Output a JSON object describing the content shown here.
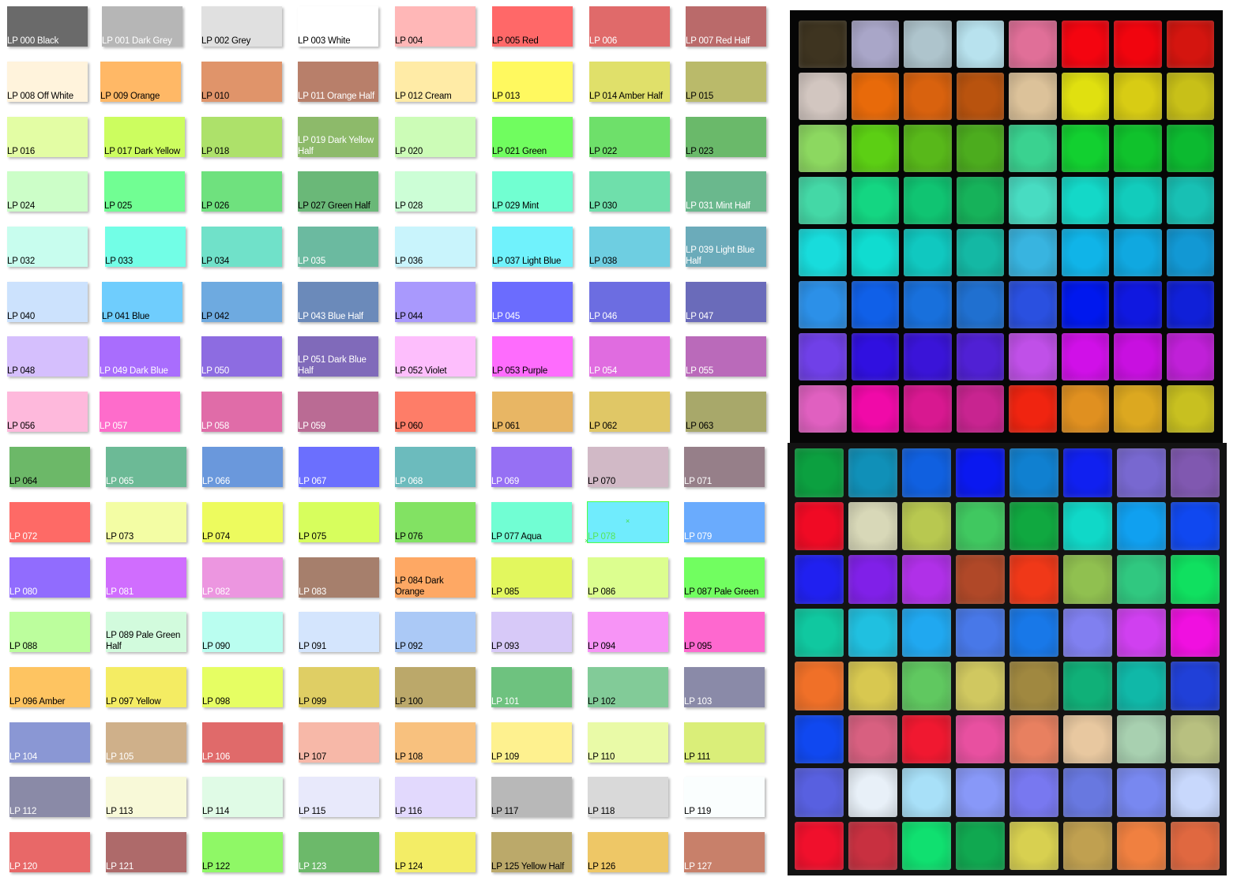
{
  "swatches": [
    {
      "label": "LP 000 Black",
      "color": "#6a6a6a",
      "text": "light"
    },
    {
      "label": "LP 001 Dark Grey",
      "color": "#b6b6b6",
      "text": "light"
    },
    {
      "label": "LP 002 Grey",
      "color": "#e0e0e0",
      "text": "dark"
    },
    {
      "label": "LP 003 White",
      "color": "#ffffff",
      "text": "dark"
    },
    {
      "label": "LP 004",
      "color": "#ffb7b7",
      "text": "dark"
    },
    {
      "label": "LP 005 Red",
      "color": "#ff6868",
      "text": "dark"
    },
    {
      "label": "LP 006",
      "color": "#e06a6a",
      "text": "light"
    },
    {
      "label": "LP 007 Red Half",
      "color": "#ba6a6a",
      "text": "light"
    },
    {
      "label": "LP 008 Off White",
      "color": "#fff3dc",
      "text": "dark"
    },
    {
      "label": "LP 009 Orange",
      "color": "#ffb866",
      "text": "dark"
    },
    {
      "label": "LP 010",
      "color": "#e0946a",
      "text": "dark"
    },
    {
      "label": "LP 011 Orange Half",
      "color": "#b87f6a",
      "text": "light"
    },
    {
      "label": "LP 012 Cream",
      "color": "#ffeba6",
      "text": "dark"
    },
    {
      "label": "LP 013",
      "color": "#fff95f",
      "text": "dark"
    },
    {
      "label": "LP 014 Amber Half",
      "color": "#e0e06a",
      "text": "dark"
    },
    {
      "label": "LP 015",
      "color": "#baba6a",
      "text": "dark"
    },
    {
      "label": "LP 016",
      "color": "#e3fda4",
      "text": "dark"
    },
    {
      "label": "LP 017 Dark Yellow",
      "color": "#ccfd5f",
      "text": "dark"
    },
    {
      "label": "LP 018",
      "color": "#ade16a",
      "text": "dark"
    },
    {
      "label": "LP 019 Dark Yellow Half",
      "color": "#8dba6a",
      "text": "light"
    },
    {
      "label": "LP 020",
      "color": "#ccfcb7",
      "text": "dark"
    },
    {
      "label": "LP 021 Green",
      "color": "#70fd5f",
      "text": "dark"
    },
    {
      "label": "LP 022",
      "color": "#6ee06a",
      "text": "dark"
    },
    {
      "label": "LP 023",
      "color": "#6ab96a",
      "text": "dark"
    },
    {
      "label": "LP 024",
      "color": "#ccfec8",
      "text": "dark"
    },
    {
      "label": "LP 025",
      "color": "#71fe93",
      "text": "dark"
    },
    {
      "label": "LP 026",
      "color": "#6fe17e",
      "text": "dark"
    },
    {
      "label": "LP 027 Green Half",
      "color": "#6ab878",
      "text": "dark"
    },
    {
      "label": "LP 028",
      "color": "#ccfed6",
      "text": "dark"
    },
    {
      "label": "LP 029 Mint",
      "color": "#71ffd1",
      "text": "dark"
    },
    {
      "label": "LP 030",
      "color": "#6fdfab",
      "text": "dark"
    },
    {
      "label": "LP 031 Mint Half",
      "color": "#6ab88d",
      "text": "light"
    },
    {
      "label": "LP 032",
      "color": "#c8fdee",
      "text": "dark"
    },
    {
      "label": "LP 033",
      "color": "#72fee6",
      "text": "dark"
    },
    {
      "label": "LP 034",
      "color": "#70e1c9",
      "text": "dark"
    },
    {
      "label": "LP 035",
      "color": "#6bbaa0",
      "text": "light"
    },
    {
      "label": "LP 036",
      "color": "#c9f4fc",
      "text": "dark"
    },
    {
      "label": "LP 037 Light Blue",
      "color": "#70f2fc",
      "text": "dark"
    },
    {
      "label": "LP 038",
      "color": "#6ecee1",
      "text": "dark"
    },
    {
      "label": "LP 039 Light Blue Half",
      "color": "#6babba",
      "text": "light"
    },
    {
      "label": "LP 040",
      "color": "#cce2fd",
      "text": "dark"
    },
    {
      "label": "LP 041 Blue",
      "color": "#6fcdfd",
      "text": "dark"
    },
    {
      "label": "LP 042",
      "color": "#6eaae0",
      "text": "dark"
    },
    {
      "label": "LP 043 Blue Half",
      "color": "#6b8aba",
      "text": "light"
    },
    {
      "label": "LP 044",
      "color": "#a999fd",
      "text": "dark"
    },
    {
      "label": "LP 045",
      "color": "#6b6cfe",
      "text": "light"
    },
    {
      "label": "LP 046",
      "color": "#6c6de1",
      "text": "light"
    },
    {
      "label": "LP 047",
      "color": "#6a6bba",
      "text": "light"
    },
    {
      "label": "LP 048",
      "color": "#d5bffd",
      "text": "dark"
    },
    {
      "label": "LP 049 Dark Blue",
      "color": "#a96dfd",
      "text": "light"
    },
    {
      "label": "LP 050",
      "color": "#8d6ce1",
      "text": "light"
    },
    {
      "label": "LP 051 Dark Blue Half",
      "color": "#806aba",
      "text": "light"
    },
    {
      "label": "LP 052 Violet",
      "color": "#fdbefc",
      "text": "dark"
    },
    {
      "label": "LP 053 Purple",
      "color": "#fe6cfd",
      "text": "dark"
    },
    {
      "label": "LP 054",
      "color": "#e06ce0",
      "text": "light"
    },
    {
      "label": "LP 055",
      "color": "#ba6aba",
      "text": "light"
    },
    {
      "label": "LP 056",
      "color": "#feb9dc",
      "text": "dark"
    },
    {
      "label": "LP 057",
      "color": "#fe6ccb",
      "text": "light"
    },
    {
      "label": "LP 058",
      "color": "#e06ca8",
      "text": "light"
    },
    {
      "label": "LP 059",
      "color": "#ba6b94",
      "text": "light"
    },
    {
      "label": "LP 060",
      "color": "#fe7d68",
      "text": "dark"
    },
    {
      "label": "LP 061",
      "color": "#e8b664",
      "text": "dark"
    },
    {
      "label": "LP 062",
      "color": "#e0c766",
      "text": "dark"
    },
    {
      "label": "LP 063",
      "color": "#a8a86a",
      "text": "dark"
    },
    {
      "label": "LP 064",
      "color": "#6cb868",
      "text": "dark"
    },
    {
      "label": "LP 065",
      "color": "#6cba96",
      "text": "light"
    },
    {
      "label": "LP 066",
      "color": "#6a98dc",
      "text": "light"
    },
    {
      "label": "LP 067",
      "color": "#6b6ffe",
      "text": "light"
    },
    {
      "label": "LP 068",
      "color": "#6cbbbd",
      "text": "light"
    },
    {
      "label": "LP 069",
      "color": "#9670f4",
      "text": "light"
    },
    {
      "label": "LP 070",
      "color": "#d1b9c6",
      "text": "dark"
    },
    {
      "label": "LP 071",
      "color": "#967f89",
      "text": "light"
    },
    {
      "label": "LP 072",
      "color": "#fe6a66",
      "text": "light"
    },
    {
      "label": "LP 073",
      "color": "#f3fda4",
      "text": "dark"
    },
    {
      "label": "LP 074",
      "color": "#edfb5e",
      "text": "dark"
    },
    {
      "label": "LP 075",
      "color": "#d7fe5d",
      "text": "dark"
    },
    {
      "label": "LP 076",
      "color": "#82e263",
      "text": "dark"
    },
    {
      "label": "LP 077 Aqua",
      "color": "#71fed3",
      "text": "dark"
    },
    {
      "label": "LP 078",
      "color": "#70ecfd",
      "text": "dark",
      "selected": true
    },
    {
      "label": "LP 079",
      "color": "#6aabfd",
      "text": "light"
    },
    {
      "label": "LP 080",
      "color": "#916cfe",
      "text": "light"
    },
    {
      "label": "LP 081",
      "color": "#d06dfe",
      "text": "light"
    },
    {
      "label": "LP 082",
      "color": "#ec96e0",
      "text": "light"
    },
    {
      "label": "LP 083",
      "color": "#a67f6c",
      "text": "light"
    },
    {
      "label": "LP 084 Dark Orange",
      "color": "#fea864",
      "text": "dark"
    },
    {
      "label": "LP 085",
      "color": "#e2f75e",
      "text": "dark"
    },
    {
      "label": "LP 086",
      "color": "#dcfe8f",
      "text": "dark"
    },
    {
      "label": "LP 087 Pale Green",
      "color": "#71fe60",
      "text": "dark"
    },
    {
      "label": "LP 088",
      "color": "#bcfe9d",
      "text": "dark"
    },
    {
      "label": "LP 089 Pale Green Half",
      "color": "#d2fbdd",
      "text": "dark"
    },
    {
      "label": "LP 090",
      "color": "#bafef0",
      "text": "dark"
    },
    {
      "label": "LP 091",
      "color": "#d4e5fd",
      "text": "dark"
    },
    {
      "label": "LP 092",
      "color": "#abc9f6",
      "text": "dark"
    },
    {
      "label": "LP 093",
      "color": "#d7c9f8",
      "text": "dark"
    },
    {
      "label": "LP 094",
      "color": "#f794f6",
      "text": "dark"
    },
    {
      "label": "LP 095",
      "color": "#fe68cf",
      "text": "dark"
    },
    {
      "label": "LP 096 Amber",
      "color": "#fec461",
      "text": "dark"
    },
    {
      "label": "LP 097 Yellow",
      "color": "#f4ec63",
      "text": "dark"
    },
    {
      "label": "LP 098",
      "color": "#e6fe63",
      "text": "dark"
    },
    {
      "label": "LP 099",
      "color": "#dfce64",
      "text": "dark"
    },
    {
      "label": "LP 100",
      "color": "#bba86a",
      "text": "dark"
    },
    {
      "label": "LP 101",
      "color": "#6ec27f",
      "text": "light"
    },
    {
      "label": "LP 102",
      "color": "#82cb98",
      "text": "dark"
    },
    {
      "label": "LP 103",
      "color": "#8a8aa8",
      "text": "light"
    },
    {
      "label": "LP 104",
      "color": "#8a97d4",
      "text": "light"
    },
    {
      "label": "LP 105",
      "color": "#cfb08a",
      "text": "light"
    },
    {
      "label": "LP 106",
      "color": "#e06a6a",
      "text": "light"
    },
    {
      "label": "LP 107",
      "color": "#f7b8a8",
      "text": "dark"
    },
    {
      "label": "LP 108",
      "color": "#f8c17e",
      "text": "dark"
    },
    {
      "label": "LP 109",
      "color": "#fef18f",
      "text": "dark"
    },
    {
      "label": "LP 110",
      "color": "#e9faa7",
      "text": "dark"
    },
    {
      "label": "LP 111",
      "color": "#daee79",
      "text": "dark"
    },
    {
      "label": "LP 112",
      "color": "#8a8aa7",
      "text": "light"
    },
    {
      "label": "LP 113",
      "color": "#f8f9d8",
      "text": "dark"
    },
    {
      "label": "LP 114",
      "color": "#e0fbe6",
      "text": "dark"
    },
    {
      "label": "LP 115",
      "color": "#e8e9fb",
      "text": "dark"
    },
    {
      "label": "LP 116",
      "color": "#e2d9fd",
      "text": "dark"
    },
    {
      "label": "LP 117",
      "color": "#b8b8b8",
      "text": "dark"
    },
    {
      "label": "LP 118",
      "color": "#d9d9d9",
      "text": "dark"
    },
    {
      "label": "LP 119",
      "color": "#fafefe",
      "text": "dark"
    },
    {
      "label": "LP 120",
      "color": "#e86868",
      "text": "light"
    },
    {
      "label": "LP 121",
      "color": "#ae6a6a",
      "text": "light"
    },
    {
      "label": "LP 122",
      "color": "#8ff866",
      "text": "dark"
    },
    {
      "label": "LP 123",
      "color": "#6cb96a",
      "text": "light"
    },
    {
      "label": "LP 124",
      "color": "#f3ed66",
      "text": "dark"
    },
    {
      "label": "LP 125 Yellow Half",
      "color": "#bba96a",
      "text": "dark"
    },
    {
      "label": "LP 126",
      "color": "#eec766",
      "text": "dark"
    },
    {
      "label": "LP 127",
      "color": "#c8806a",
      "text": "light"
    }
  ],
  "photo_top": {
    "pads": [
      "#3e3420",
      "#a9a6c8",
      "#aec4cc",
      "#b8e2ee",
      "#e06f98",
      "#f40510",
      "#f1050e",
      "#d4150f",
      "#d2c6c0",
      "#e86a0a",
      "#d9620e",
      "#b9530e",
      "#dcc29a",
      "#e0e010",
      "#d8cc14",
      "#c8c018",
      "#8cd860",
      "#5ccf14",
      "#58b81a",
      "#4cac1e",
      "#3ad290",
      "#12d030",
      "#10c22c",
      "#0cba30",
      "#44d8a6",
      "#14d682",
      "#10c472",
      "#16b25a",
      "#48dcc2",
      "#14d8c8",
      "#12ccbc",
      "#18c0b4",
      "#18dcdc",
      "#10dcd0",
      "#10c8c0",
      "#14b8a4",
      "#38b4e0",
      "#10b4e8",
      "#10a8e0",
      "#1298d4",
      "#2c90e8",
      "#1060e8",
      "#1870dc",
      "#2070d0",
      "#2a50e0",
      "#0018ee",
      "#1018e0",
      "#1020d8",
      "#7040e8",
      "#3010e0",
      "#3a14d8",
      "#5020d4",
      "#c050e8",
      "#d010e8",
      "#c810e0",
      "#c020d8",
      "#e060c0",
      "#f00aa8",
      "#d81890",
      "#c82490",
      "#f02410",
      "#e09020",
      "#dca820",
      "#c8c020"
    ]
  },
  "photo_bottom": {
    "pads": [
      "#0ca040",
      "#1090b8",
      "#1060e0",
      "#0a18f0",
      "#1080d0",
      "#1020f0",
      "#7868d0",
      "#8058b0",
      "#f00a24",
      "#d8d8b8",
      "#b8c850",
      "#40c860",
      "#10a840",
      "#10d8c8",
      "#10a0f0",
      "#1048f0",
      "#2020f0",
      "#8020e8",
      "#b030e8",
      "#b04828",
      "#f03818",
      "#90c050",
      "#30c880",
      "#10e060",
      "#10c8a0",
      "#20c0e0",
      "#20a8f0",
      "#4878e8",
      "#1878e8",
      "#8080f0",
      "#d040f0",
      "#f010e0",
      "#f07028",
      "#d8c850",
      "#60c860",
      "#d0c860",
      "#a08840",
      "#10b078",
      "#10b8a8",
      "#2040d8",
      "#1048f0",
      "#d86080",
      "#f01830",
      "#e850a0",
      "#e88060",
      "#e8c8a0",
      "#a8d0b0",
      "#b8c080",
      "#5860e0",
      "#e8f0f8",
      "#a8e0f8",
      "#8898f8",
      "#7878f0",
      "#6878e0",
      "#7888f0",
      "#c8d8fc",
      "#f0102c",
      "#c83040",
      "#10e070",
      "#10a850",
      "#d8d050",
      "#c0a050",
      "#f08040",
      "#e06840"
    ]
  }
}
